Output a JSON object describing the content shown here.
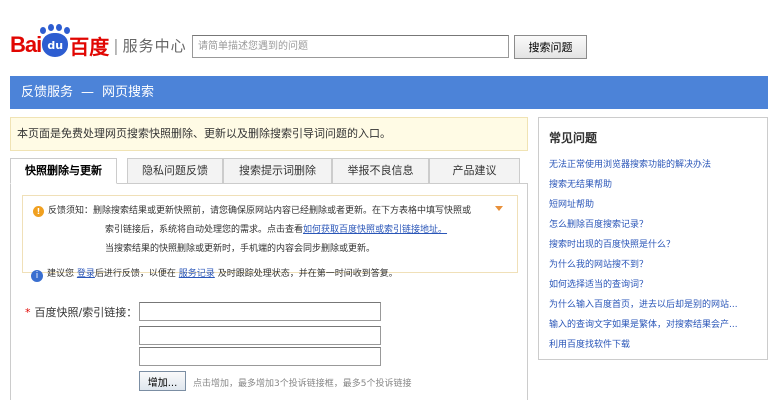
{
  "header": {
    "logo_bai": "Bai",
    "logo_du": "du",
    "logo_cn": "百度",
    "logo_sep": "|",
    "logo_service": "服务中心",
    "search_placeholder": "请简单描述您遇到的问题",
    "search_button": "搜索问题"
  },
  "titlebar": {
    "section": "反馈服务",
    "dash": "—",
    "page": "网页搜索"
  },
  "notice": "本页面是免费处理网页搜索快照删除、更新以及删除搜索引导词问题的入口。",
  "tabs": [
    {
      "label": "快照删除与更新",
      "active": true
    },
    {
      "label": "隐私问题反馈",
      "active": false
    },
    {
      "label": "搜索提示词删除",
      "active": false
    },
    {
      "label": "举报不良信息",
      "active": false
    },
    {
      "label": "产品建议",
      "active": false
    }
  ],
  "feedback": {
    "heading": "反馈须知：",
    "line1": "删除搜索结果或更新快照前，请您确保原网站内容已经删除或者更新。在下方表格中填写快照或",
    "line2a": "索引链接后，系统将自动处理您的需求。点击查看",
    "line2_link": "如何获取百度快照或索引链接地址。",
    "line3": "当搜索结果的快照删除或更新时，手机端的内容会同步删除或更新。"
  },
  "suggestion": {
    "a": "建议您",
    "login": "登录",
    "b": "后进行反馈，以便在",
    "records": "服务记录",
    "c": "及时跟踪处理状态，并在第一时间收到答复。"
  },
  "form": {
    "star": "*",
    "label": "百度快照/索引链接：",
    "add_button": "增加...",
    "add_hint": "点击增加，最多增加3个投诉链接框，最多5个投诉链接"
  },
  "faq": {
    "title": "常见问题",
    "items": [
      "无法正常使用浏览器搜索功能的解决办法",
      "搜索无结果帮助",
      "短网址帮助",
      "怎么删除百度搜索记录？",
      "搜索时出现的百度快照是什么？",
      "为什么我的网站搜不到？",
      "如何选择适当的查询词？",
      "为什么输入百度首页，进去以后却是别的网站...",
      "输入的查询文字如果是繁体，对搜索结果会产...",
      "利用百度找软件下载"
    ]
  }
}
